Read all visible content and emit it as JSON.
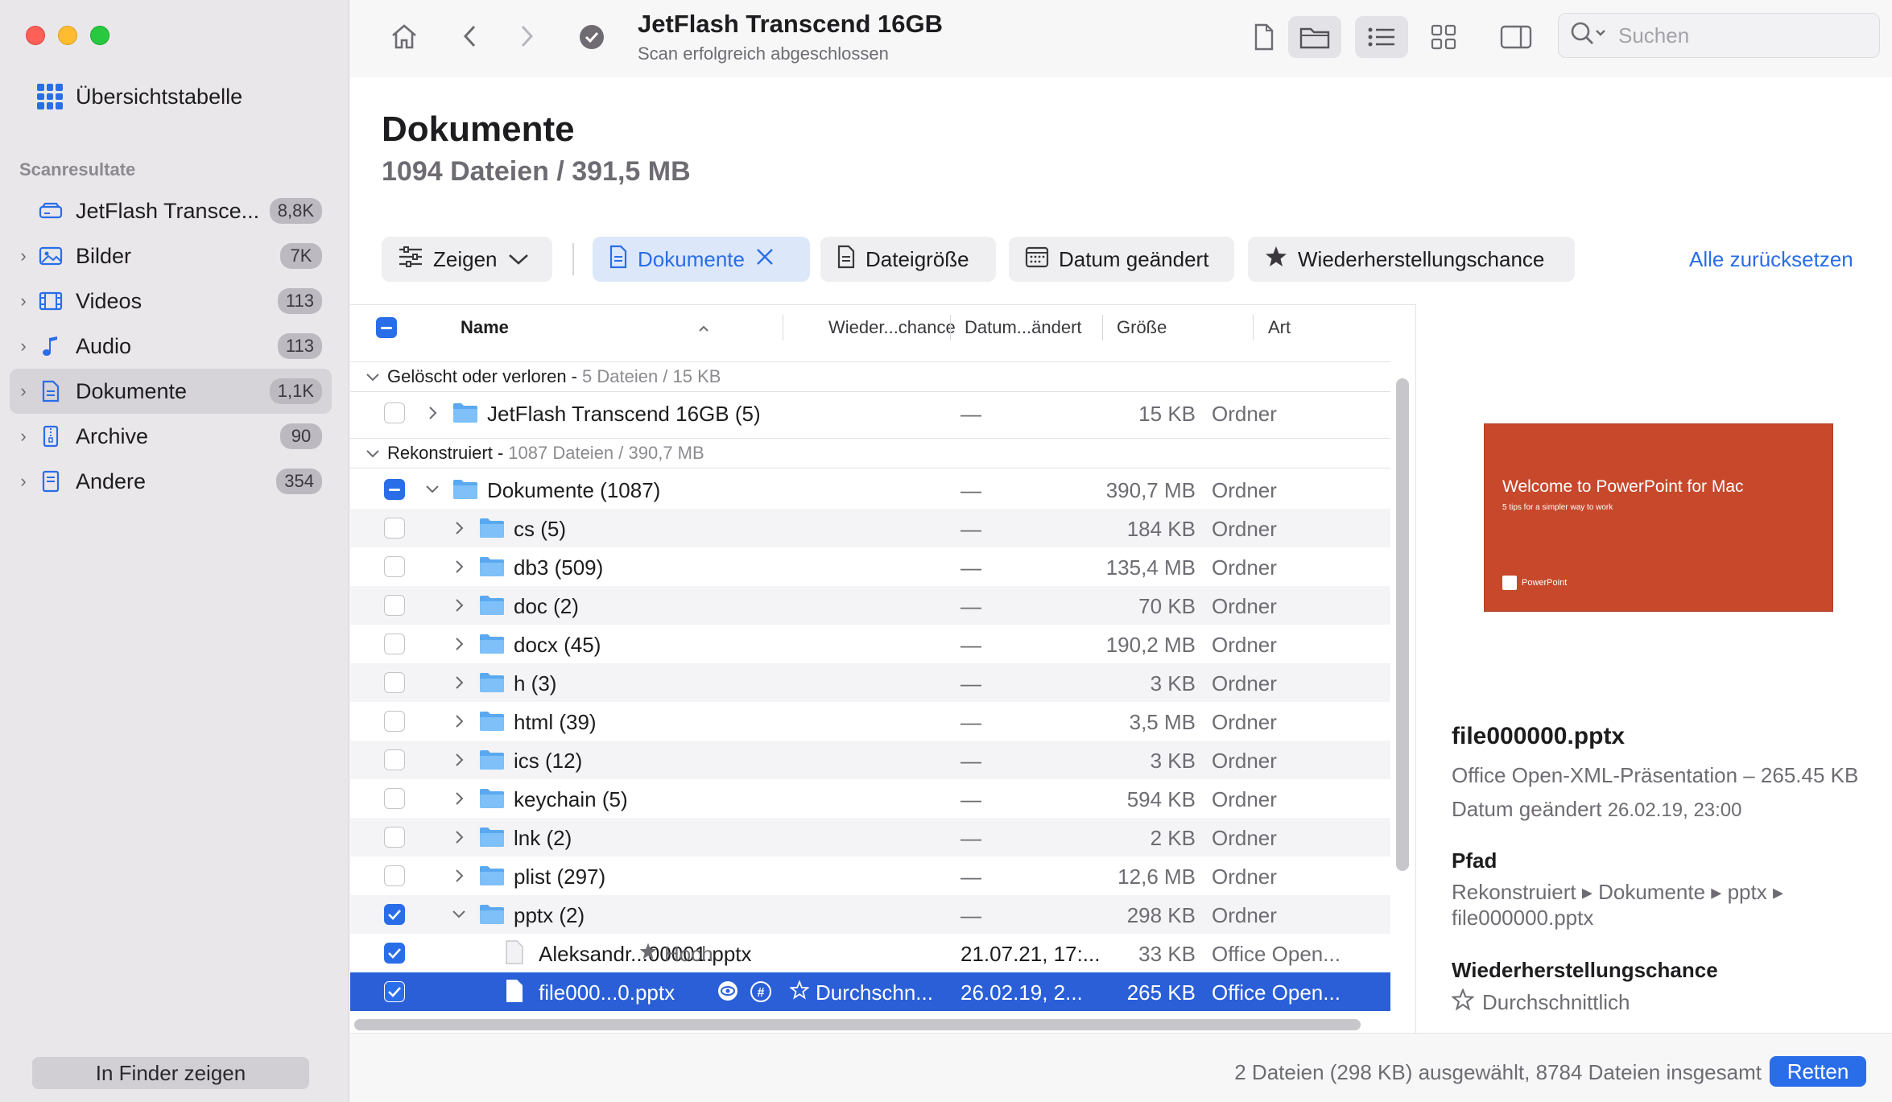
{
  "sidebar": {
    "overview_label": "Übersichtstabelle",
    "section_label": "Scanresultate",
    "items": [
      {
        "label": "JetFlash Transce...",
        "badge": "8,8K",
        "icon": "drive-icon"
      },
      {
        "label": "Bilder",
        "badge": "7K",
        "icon": "photo-icon"
      },
      {
        "label": "Videos",
        "badge": "113",
        "icon": "film-icon"
      },
      {
        "label": "Audio",
        "badge": "113",
        "icon": "music-note-icon"
      },
      {
        "label": "Dokumente",
        "badge": "1,1K",
        "icon": "document-icon"
      },
      {
        "label": "Archive",
        "badge": "90",
        "icon": "archive-icon"
      },
      {
        "label": "Andere",
        "badge": "354",
        "icon": "file-icon"
      }
    ],
    "finder_button": "In Finder zeigen"
  },
  "toolbar": {
    "title": "JetFlash Transcend 16GB",
    "subtitle": "Scan erfolgreich abgeschlossen",
    "search_placeholder": "Suchen"
  },
  "page": {
    "title": "Dokumente",
    "subtitle": "1094 Dateien / 391,5 MB"
  },
  "filters": {
    "show": "Zeigen",
    "documents": "Dokumente",
    "filesize": "Dateigröße",
    "date_changed": "Datum geändert",
    "recovery_chance": "Wiederherstellungschance",
    "reset_all": "Alle zurücksetzen"
  },
  "table": {
    "columns": {
      "name": "Name",
      "chance": "Wieder...chance",
      "date": "Datum...ändert",
      "size": "Größe",
      "kind": "Art"
    },
    "groups": [
      {
        "label": "Gelöscht oder verloren -",
        "meta": "5 Dateien / 15 KB"
      },
      {
        "label": "Rekonstruiert -",
        "meta": "1087 Dateien / 390,7 MB"
      }
    ],
    "rows": [
      {
        "name": "JetFlash Transcend 16GB (5)",
        "chance": "",
        "date": "—",
        "size": "15 KB",
        "kind": "Ordner"
      },
      {
        "name": "Dokumente (1087)",
        "chance": "",
        "date": "—",
        "size": "390,7 MB",
        "kind": "Ordner"
      },
      {
        "name": "cs (5)",
        "chance": "",
        "date": "—",
        "size": "184 KB",
        "kind": "Ordner"
      },
      {
        "name": "db3 (509)",
        "chance": "",
        "date": "—",
        "size": "135,4 MB",
        "kind": "Ordner"
      },
      {
        "name": "doc (2)",
        "chance": "",
        "date": "—",
        "size": "70 KB",
        "kind": "Ordner"
      },
      {
        "name": "docx (45)",
        "chance": "",
        "date": "—",
        "size": "190,2 MB",
        "kind": "Ordner"
      },
      {
        "name": "h (3)",
        "chance": "",
        "date": "—",
        "size": "3 KB",
        "kind": "Ordner"
      },
      {
        "name": "html (39)",
        "chance": "",
        "date": "—",
        "size": "3,5 MB",
        "kind": "Ordner"
      },
      {
        "name": "ics (12)",
        "chance": "",
        "date": "—",
        "size": "3 KB",
        "kind": "Ordner"
      },
      {
        "name": "keychain (5)",
        "chance": "",
        "date": "—",
        "size": "594 KB",
        "kind": "Ordner"
      },
      {
        "name": "lnk (2)",
        "chance": "",
        "date": "—",
        "size": "2 KB",
        "kind": "Ordner"
      },
      {
        "name": "plist (297)",
        "chance": "",
        "date": "—",
        "size": "12,6 MB",
        "kind": "Ordner"
      },
      {
        "name": "pptx (2)",
        "chance": "",
        "date": "—",
        "size": "298 KB",
        "kind": "Ordner"
      },
      {
        "name": "Aleksandr...00001.pptx",
        "chance": "Hoch",
        "date": "21.07.21, 17:...",
        "size": "33 KB",
        "kind": "Office Open..."
      },
      {
        "name": "file000...0.pptx",
        "chance": "Durchschn...",
        "date": "26.02.19, 2...",
        "size": "265 KB",
        "kind": "Office Open..."
      }
    ]
  },
  "preview": {
    "slide_title": "Welcome to PowerPoint for Mac",
    "slide_subtitle": "5 tips for a simpler way to work",
    "slide_brand": "PowerPoint",
    "file_name": "file000000.pptx",
    "file_type": "Office Open-XML-Präsentation – 265.45 KB",
    "date_label": "Datum geändert",
    "date_value": "26.02.19, 23:00",
    "path_heading": "Pfad",
    "path_value": "Rekonstruiert ▸ Dokumente ▸ pptx ▸ file000000.pptx",
    "chance_heading": "Wiederherstellungschance",
    "chance_value": "Durchschnittlich"
  },
  "status": {
    "summary": "2 Dateien (298 KB) ausgewählt, 8784 Dateien insgesamt",
    "recover_button": "Retten"
  },
  "colors": {
    "accent": "#2a6de8",
    "selection": "#2a5fd8",
    "slide": "#c7482b"
  }
}
